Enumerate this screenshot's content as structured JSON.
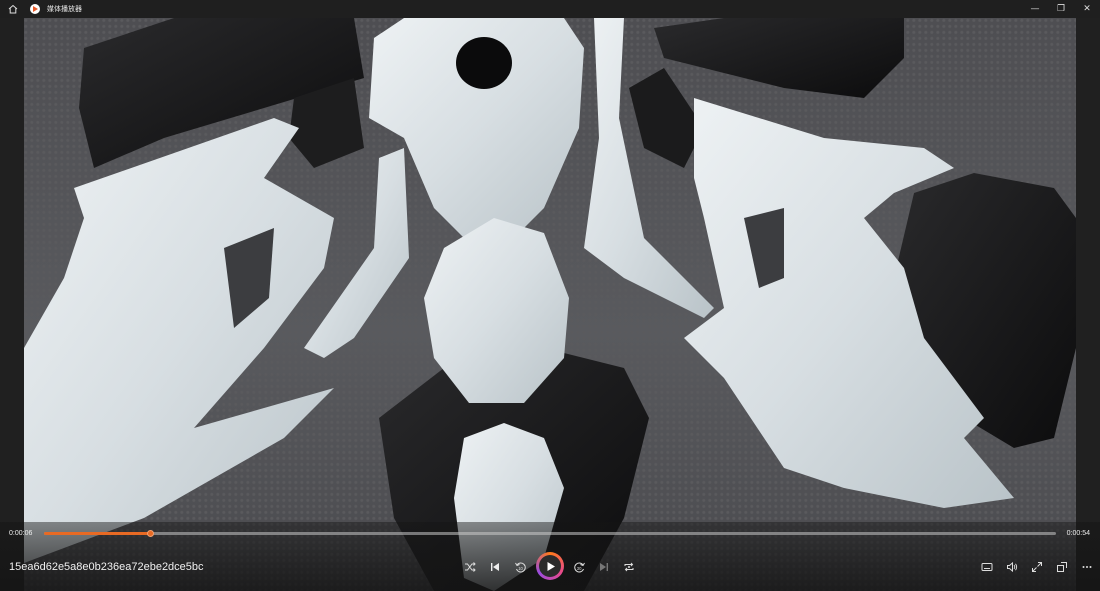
{
  "window": {
    "title": "媒体播放器",
    "minimize": "—",
    "maximize": "❐",
    "close": "✕"
  },
  "player": {
    "current_time": "0:00:06",
    "total_time": "0:00:54",
    "progress": 0.105,
    "filename": "15ea6d62e5a8e0b236ea72ebe2dce5bc",
    "accent": "#e86a24"
  },
  "icons": {
    "home": "home-icon",
    "shuffle": "shuffle-icon",
    "previous": "previous-icon",
    "back10": "rewind-10-icon",
    "play": "play-icon",
    "forward30": "forward-30-icon",
    "next": "next-icon",
    "repeat": "repeat-icon",
    "subtitles": "subtitles-icon",
    "volume": "volume-icon",
    "fullscreen": "fullscreen-icon",
    "miniplayer": "mini-player-icon",
    "more": "more-icon"
  }
}
